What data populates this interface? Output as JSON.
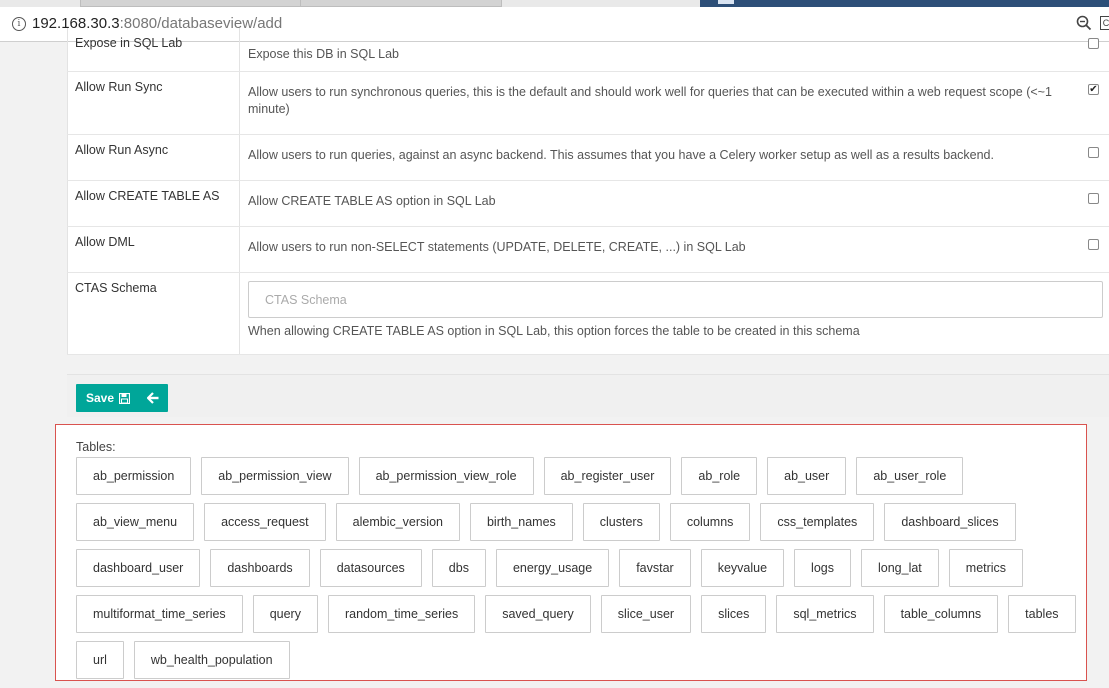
{
  "browser": {
    "url_host": "192.168.30.3",
    "url_path": ":8080/databaseview/add"
  },
  "form": {
    "rows": [
      {
        "label": "Expose in SQL Lab",
        "description": "Expose this DB in SQL Lab",
        "checked": false
      },
      {
        "label": "Allow Run Sync",
        "description": "Allow users to run synchronous queries, this is the default and should work well for queries that can be executed within a web request scope (<~1 minute)",
        "checked": true
      },
      {
        "label": "Allow Run Async",
        "description": "Allow users to run queries, against an async backend. This assumes that you have a Celery worker setup as well as a results backend.",
        "checked": false
      },
      {
        "label": "Allow CREATE TABLE AS",
        "description": "Allow CREATE TABLE AS option in SQL Lab",
        "checked": false
      },
      {
        "label": "Allow DML",
        "description": "Allow users to run non-SELECT statements (UPDATE, DELETE, CREATE, ...) in SQL Lab",
        "checked": false
      }
    ],
    "ctas": {
      "label": "CTAS Schema",
      "placeholder": "CTAS Schema",
      "value": "",
      "help": "When allowing CREATE TABLE AS option in SQL Lab, this option forces the table to be created in this schema"
    }
  },
  "actions": {
    "save_label": "Save"
  },
  "tables": {
    "label": "Tables:",
    "items": [
      "ab_permission",
      "ab_permission_view",
      "ab_permission_view_role",
      "ab_register_user",
      "ab_role",
      "ab_user",
      "ab_user_role",
      "ab_view_menu",
      "access_request",
      "alembic_version",
      "birth_names",
      "clusters",
      "columns",
      "css_templates",
      "dashboard_slices",
      "dashboard_user",
      "dashboards",
      "datasources",
      "dbs",
      "energy_usage",
      "favstar",
      "keyvalue",
      "logs",
      "long_lat",
      "metrics",
      "multiformat_time_series",
      "query",
      "random_time_series",
      "saved_query",
      "slice_user",
      "slices",
      "sql_metrics",
      "table_columns",
      "tables",
      "url",
      "wb_health_population"
    ]
  },
  "colors": {
    "primary": "#00a699",
    "box_border": "#d9534f"
  }
}
